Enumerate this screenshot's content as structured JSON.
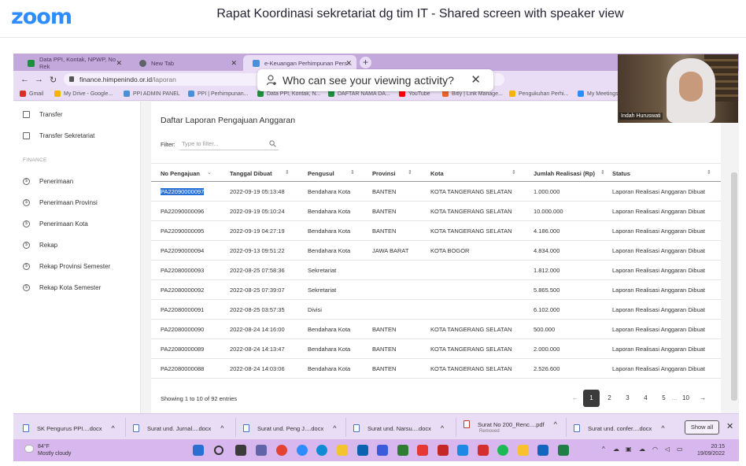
{
  "zoom": {
    "logo": "zoom",
    "title": "Rapat Koordinasi sekretariat dg tim IT - Shared screen with speaker view"
  },
  "browser": {
    "tabs": [
      {
        "label": "Data PPI, Kontak, NPWP, No Rek",
        "close": "✕"
      },
      {
        "label": "New Tab",
        "close": "✕"
      },
      {
        "label": "e-Keuangan Perhimpunan Pers...",
        "close": "✕"
      }
    ],
    "new_tab": "+",
    "url_host": "finance.himpenindo.or.id",
    "url_path": "/laporan",
    "bookmarks": [
      "Gmail",
      "My Drive - Google...",
      "PPI ADMIN PANEL",
      "PPI | Perhimpunan...",
      "Data PPI, Kontak, N...",
      "DAFTAR NAMA DA...",
      "YouTube",
      "Bitly | Link Manage...",
      "Pengukuhan Perhi...",
      "My Meetings"
    ],
    "colors": {
      "tabbar": "#c3a8dc",
      "toolbar": "#e9dcf5"
    }
  },
  "popup": {
    "text": "Who can see your viewing activity?",
    "close": "✕"
  },
  "sidebar": {
    "items_top": [
      {
        "label": "Transfer",
        "icon": "document-icon"
      },
      {
        "label": "Transfer Sekretariat",
        "icon": "document-icon"
      }
    ],
    "section": "FINANCE",
    "items_finance": [
      {
        "label": "Penerimaan",
        "icon": "dollar-icon"
      },
      {
        "label": "Penerimaan Provinsi",
        "icon": "dollar-icon"
      },
      {
        "label": "Penerimaan Kota",
        "icon": "dollar-icon"
      },
      {
        "label": "Rekap",
        "icon": "dollar-icon"
      },
      {
        "label": "Rekap Provinsi Semester",
        "icon": "dollar-icon"
      },
      {
        "label": "Rekap Kota Semester",
        "icon": "dollar-icon"
      }
    ]
  },
  "report": {
    "title": "Daftar Laporan Pengajuan Anggaran",
    "filter_label": "Filter:",
    "filter_placeholder": "Type to filter...",
    "columns": [
      "No Pengajuan",
      "Tanggal Dibuat",
      "Pengusul",
      "Provinsi",
      "Kota",
      "Jumlah Realisasi (Rp)",
      "Status"
    ],
    "rows": [
      [
        "PA22090000097",
        "2022-09-19 05:13:48",
        "Bendahara Kota",
        "BANTEN",
        "KOTA TANGERANG SELATAN",
        "1.000.000",
        "Laporan Realisasi Anggaran Dibuat"
      ],
      [
        "PA22090000096",
        "2022-09-19 05:10:24",
        "Bendahara Kota",
        "BANTEN",
        "KOTA TANGERANG SELATAN",
        "10.000.000",
        "Laporan Realisasi Anggaran Dibuat"
      ],
      [
        "PA22090000095",
        "2022-09-19 04:27:19",
        "Bendahara Kota",
        "BANTEN",
        "KOTA TANGERANG SELATAN",
        "4.186.000",
        "Laporan Realisasi Anggaran Dibuat"
      ],
      [
        "PA22090000094",
        "2022-09-13 09:51:22",
        "Bendahara Kota",
        "JAWA BARAT",
        "KOTA BOGOR",
        "4.834.000",
        "Laporan Realisasi Anggaran Dibuat"
      ],
      [
        "PA22080000093",
        "2022-08-25 07:58:36",
        "Sekretariat",
        "",
        "",
        "1.812.000",
        "Laporan Realisasi Anggaran Dibuat"
      ],
      [
        "PA22080000092",
        "2022-08-25 07:39:07",
        "Sekretariat",
        "",
        "",
        "5.865.500",
        "Laporan Realisasi Anggaran Dibuat"
      ],
      [
        "PA22080000091",
        "2022-08-25 03:57:35",
        "Divisi",
        "",
        "",
        "6.102.000",
        "Laporan Realisasi Anggaran Dibuat"
      ],
      [
        "PA22080000090",
        "2022-08-24 14:16:00",
        "Bendahara Kota",
        "BANTEN",
        "KOTA TANGERANG SELATAN",
        "500.000",
        "Laporan Realisasi Anggaran Dibuat"
      ],
      [
        "PA22080000089",
        "2022-08-24 14:13:47",
        "Bendahara Kota",
        "BANTEN",
        "KOTA TANGERANG SELATAN",
        "2.000.000",
        "Laporan Realisasi Anggaran Dibuat"
      ],
      [
        "PA22080000088",
        "2022-08-24 14:03:06",
        "Bendahara Kota",
        "BANTEN",
        "KOTA TANGERANG SELATAN",
        "2.526.600",
        "Laporan Realisasi Anggaran Dibuat"
      ]
    ],
    "footer_info": "Showing 1 to 10 of 92 entries",
    "pagination": [
      "←",
      "1",
      "2",
      "3",
      "4",
      "5",
      "...",
      "10",
      "→"
    ],
    "active_page": "1"
  },
  "downloads": {
    "items": [
      {
        "name": "SK Pengurus PPI....docx",
        "sub": ""
      },
      {
        "name": "Surat und. Jurnal....docx",
        "sub": ""
      },
      {
        "name": "Surat und. Peng J....docx",
        "sub": ""
      },
      {
        "name": "Surat und. Narsu....docx",
        "sub": ""
      },
      {
        "name": "Surat No 200_Renc....pdf",
        "sub": "Removed"
      },
      {
        "name": "Surat und. confer....docx",
        "sub": ""
      }
    ],
    "show_all": "Show all",
    "close": "✕"
  },
  "taskbar": {
    "temp": "84°F",
    "condition": "Mostly cloudy",
    "time": "20:15",
    "date": "19/09/2022",
    "tray_expand": "^"
  },
  "video": {
    "name": "Indah Huruswati"
  }
}
